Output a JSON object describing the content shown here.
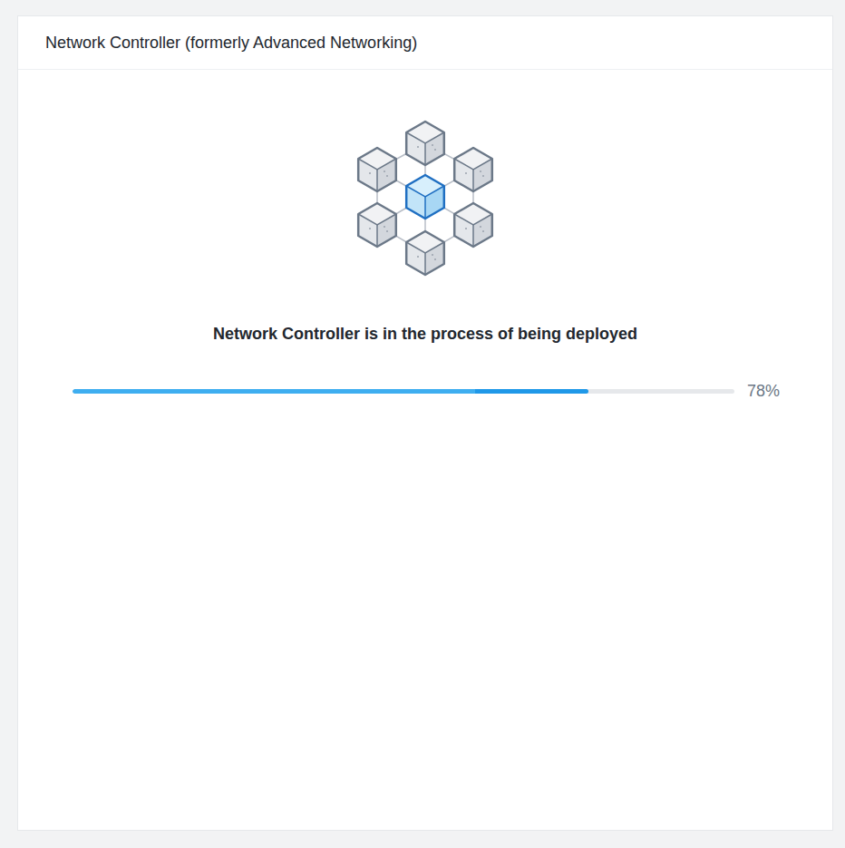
{
  "panel": {
    "title": "Network Controller (formerly Advanced Networking)"
  },
  "status": {
    "message": "Network Controller is in the process of being deployed",
    "level": 0.78,
    "reading": "78%"
  }
}
